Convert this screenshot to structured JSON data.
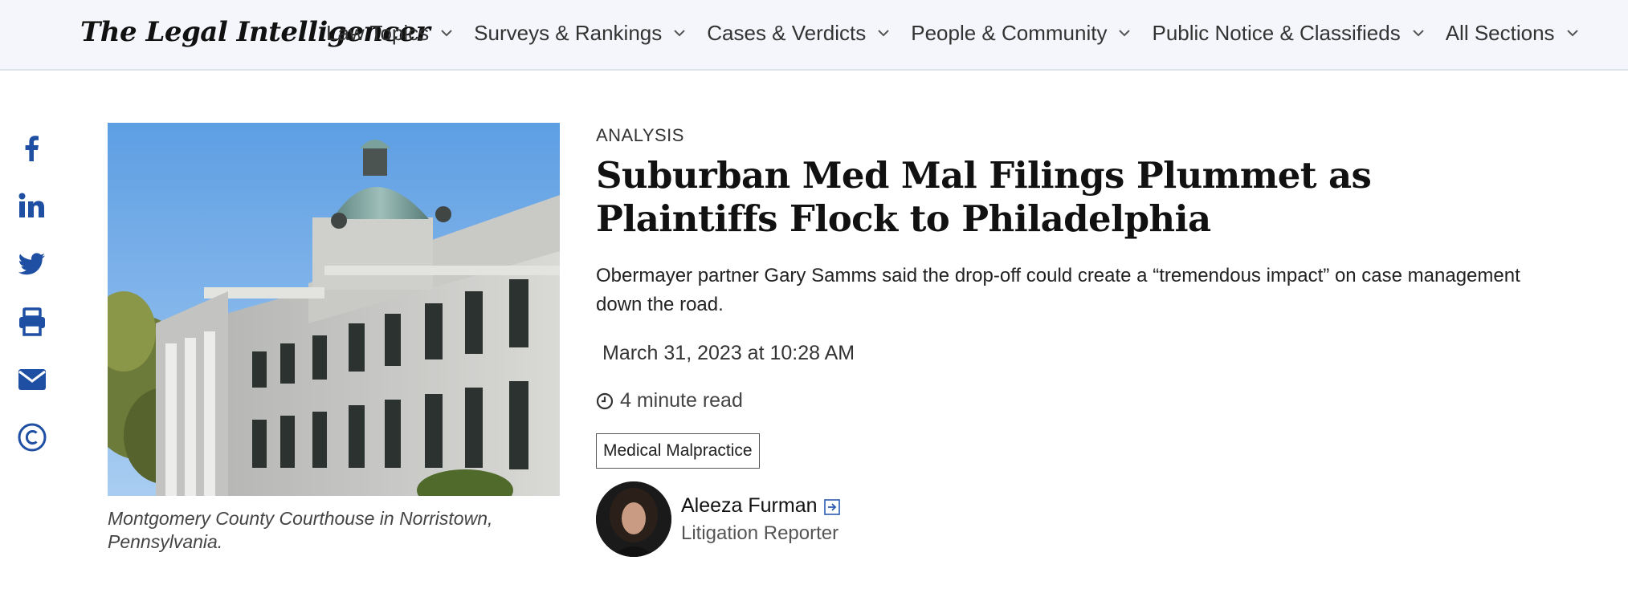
{
  "site": {
    "logo_text": "The Legal Intelligencer"
  },
  "nav": {
    "items": [
      {
        "label": "Law Topics"
      },
      {
        "label": "Surveys & Rankings"
      },
      {
        "label": "Cases & Verdicts"
      },
      {
        "label": "People & Community"
      },
      {
        "label": "Public Notice & Classifieds"
      },
      {
        "label": "All Sections"
      }
    ]
  },
  "share": {
    "icons": [
      "facebook-icon",
      "linkedin-icon",
      "twitter-icon",
      "print-icon",
      "email-icon",
      "copyright-icon"
    ],
    "color": "#1f4fa3"
  },
  "article": {
    "kicker": "ANALYSIS",
    "headline": "Suburban Med Mal Filings Plummet as Plaintiffs Flock to Philadelphia",
    "dek": "Obermayer partner Gary Samms said the drop-off could create a “tremendous impact” on case management down the road.",
    "date": "March 31, 2023 at 10:28 AM",
    "read_time": "4 minute read",
    "tag": "Medical Malpractice",
    "image_caption": "Montgomery County Courthouse in Norristown, Pennsylvania.",
    "author": {
      "name": "Aleeza Furman",
      "role": "Litigation Reporter"
    }
  }
}
